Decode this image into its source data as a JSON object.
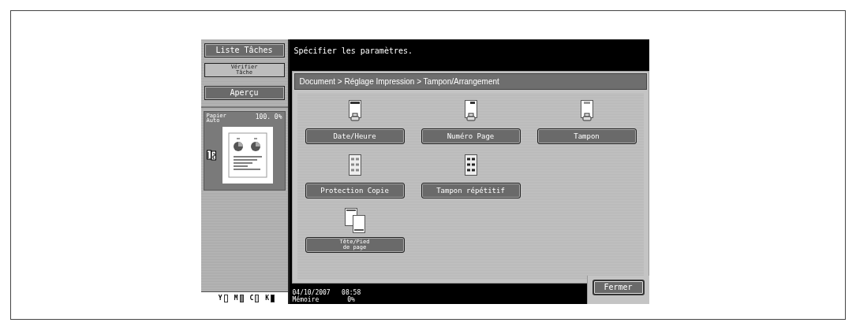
{
  "sidebar": {
    "buttons": [
      {
        "label": "Liste Tâches"
      },
      {
        "label": "Vérifier\nTâche"
      },
      {
        "label": "Aperçu"
      }
    ],
    "preview": {
      "paper": "Papier\nAuto",
      "zoom": "100. 0%"
    },
    "toners": [
      {
        "label": "Y",
        "color": "#ffffff"
      },
      {
        "label": "M",
        "color": "#808080"
      },
      {
        "label": "C",
        "color": "#d0d0d0"
      },
      {
        "label": "K",
        "color": "#000000"
      }
    ]
  },
  "message": "Spécifier les paramètres.",
  "breadcrumb": "Document > Réglage Impression > Tampon/Arrangement",
  "option_rows": [
    [
      {
        "label": "Date/Heure",
        "kind": "date"
      },
      {
        "label": "Numéro Page",
        "kind": "page-number"
      },
      {
        "label": "Tampon",
        "kind": "stamp"
      }
    ],
    [
      {
        "label": "Protection Copie",
        "kind": "copy-protection"
      },
      {
        "label": "Tampon répétitif",
        "kind": "repeat-stamp"
      }
    ],
    [
      {
        "label": "Tête/Pied\nde page",
        "kind": "header-footer"
      }
    ]
  ],
  "status": {
    "datetime": "04/10/2007   08:58",
    "memory": "Mémoire",
    "memory_value": "0%"
  },
  "close_button": "Fermer"
}
